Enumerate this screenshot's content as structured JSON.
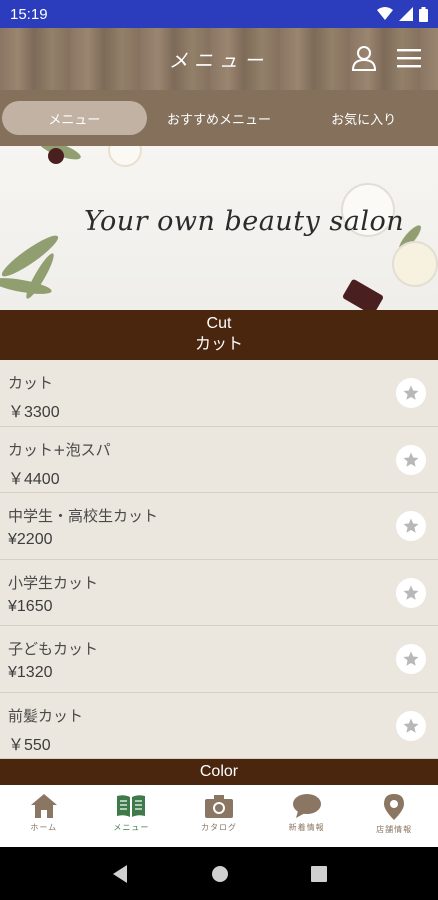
{
  "status_bar": {
    "time": "15:19"
  },
  "header": {
    "title": "メニュー"
  },
  "tabs": [
    {
      "label": "メニュー",
      "active": true
    },
    {
      "label": "おすすめメニュー",
      "active": false
    },
    {
      "label": "お気に入り",
      "active": false
    }
  ],
  "banner": {
    "text": "Your own beauty salon"
  },
  "sections": [
    {
      "title_en": "Cut",
      "title_ja": "カット"
    },
    {
      "title_en": "Color"
    }
  ],
  "menu_items": [
    {
      "name": "カット",
      "price": "￥3300"
    },
    {
      "name": "カット+泡スパ",
      "price": "￥4400"
    },
    {
      "name": "中学生・高校生カット",
      "price": "¥2200"
    },
    {
      "name": "小学生カット",
      "price": "¥1650"
    },
    {
      "name": "子どもカット",
      "price": "¥1320"
    },
    {
      "name": "前髪カット",
      "price": "￥550"
    }
  ],
  "bottom_nav": [
    {
      "label": "ホーム",
      "icon": "home-icon",
      "active": false
    },
    {
      "label": "メニュー",
      "icon": "book-icon",
      "active": true
    },
    {
      "label": "カタログ",
      "icon": "camera-icon",
      "active": false
    },
    {
      "label": "新着情報",
      "icon": "chat-bubble-icon",
      "active": false
    },
    {
      "label": "店舗情報",
      "icon": "map-pin-icon",
      "active": false
    }
  ],
  "colors": {
    "status_bar": "#2b3dbd",
    "tab_bar": "#85705c",
    "tab_active": "#c1b2a3",
    "section_header": "#4a260f",
    "list_bg": "#ece7de",
    "nav_icon": "#8a7663",
    "nav_icon_active": "#3e7a4a"
  }
}
